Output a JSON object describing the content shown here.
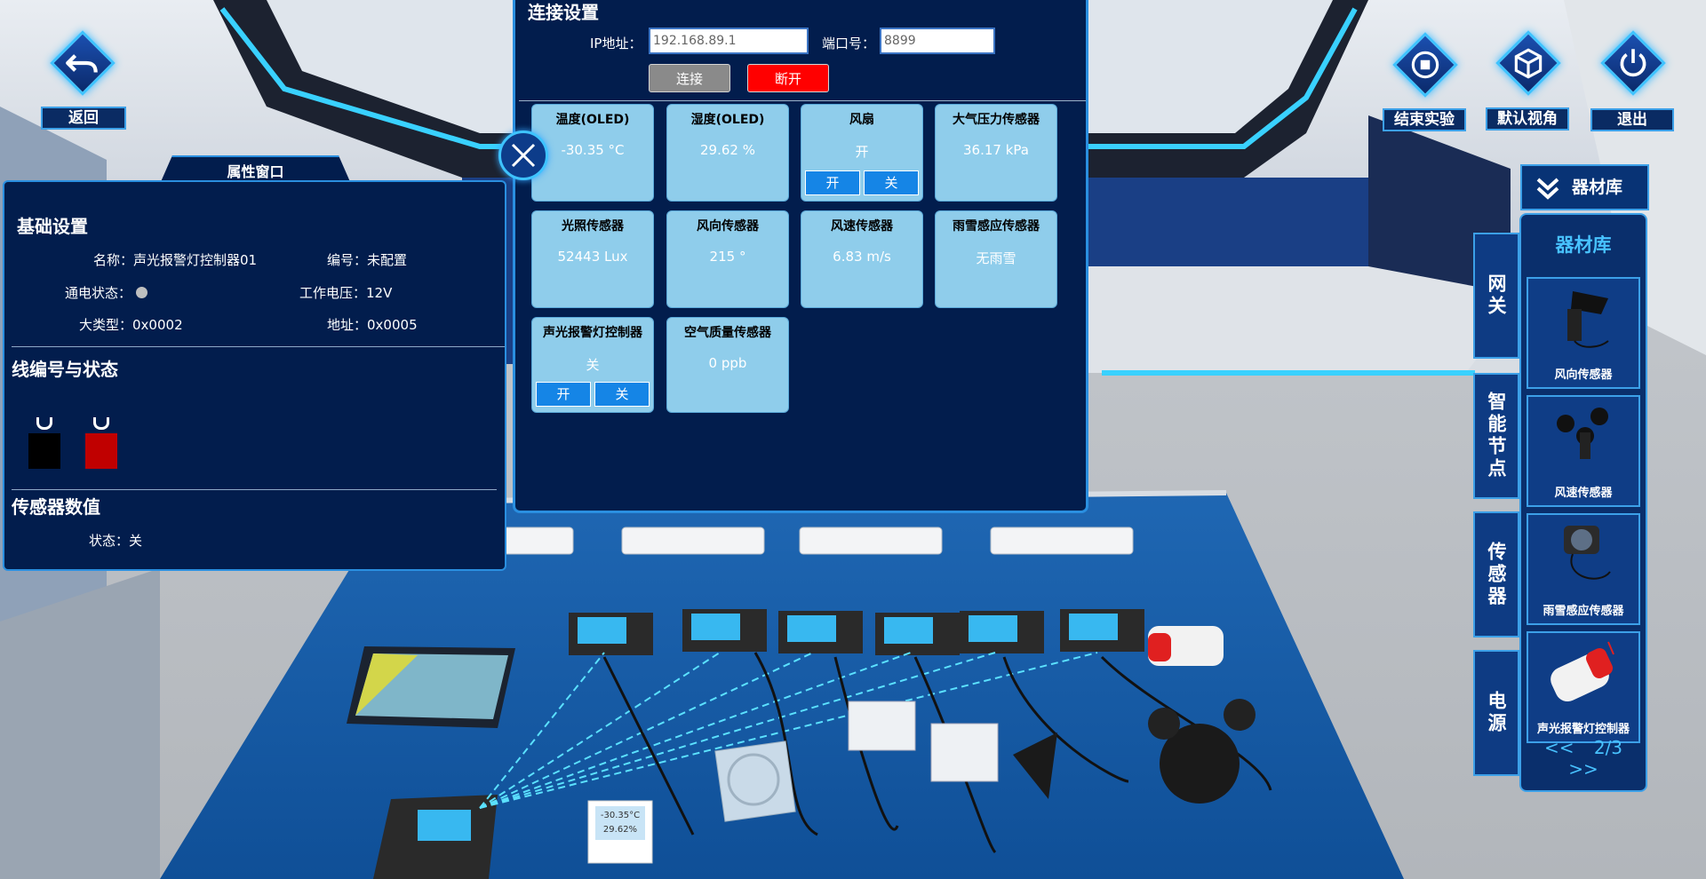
{
  "top_left": {
    "back_label": "返回"
  },
  "top_right": {
    "end_label": "结束实验",
    "view_label": "默认视角",
    "exit_label": "退出"
  },
  "prop_window": {
    "tab": "属性窗口",
    "basic_title": "基础设置",
    "name_key": "名称：",
    "name_val": "声光报警灯控制器01",
    "id_key": "编号：",
    "id_val": "未配置",
    "power_key": "通电状态：",
    "voltage_key": "工作电压：",
    "voltage_val": "12V",
    "type_key": "大类型：",
    "type_val": "0x0002",
    "addr_key": "地址：",
    "addr_val": "0x0005",
    "wire_title": "线编号与状态",
    "sensor_title": "传感器数值",
    "state_key": "状态：",
    "state_val": "关"
  },
  "connection": {
    "title": "连接设置",
    "ip_label": "IP地址：",
    "ip_value": "192.168.89.1",
    "port_label": "端口号：",
    "port_value": "8899",
    "connect_label": "连接",
    "disconnect_label": "断开",
    "cards": [
      {
        "title": "温度(OLED)",
        "value": "-30.35 °C"
      },
      {
        "title": "湿度(OLED)",
        "value": "29.62 %"
      },
      {
        "title": "风扇",
        "value": "开",
        "on": "开",
        "off": "关"
      },
      {
        "title": "大气压力传感器",
        "value": "36.17 kPa"
      },
      {
        "title": "光照传感器",
        "value": "52443 Lux"
      },
      {
        "title": "风向传感器",
        "value": "215 °"
      },
      {
        "title": "风速传感器",
        "value": "6.83 m/s"
      },
      {
        "title": "雨雪感应传感器",
        "value": "无雨雪"
      },
      {
        "title": "声光报警灯控制器",
        "value": "关",
        "on": "开",
        "off": "关"
      },
      {
        "title": "空气质量传感器",
        "value": "0 ppb"
      }
    ]
  },
  "library": {
    "header": "器材库",
    "title": "器材库",
    "tabs": [
      "网关",
      "智能节点",
      "传感器",
      "电源"
    ],
    "items": [
      "风向传感器",
      "风速传感器",
      "雨雪感应传感器",
      "声光报警灯控制器"
    ],
    "prev": "<<",
    "page": "2/3",
    "next": ">>"
  },
  "scene": {
    "oled_temp": "-30.35°C",
    "oled_humi": "29.62%"
  },
  "colors": {
    "panel_bg": "#021d4d",
    "accent": "#3ec3ff",
    "card_bg": "#8fcdeb",
    "disconnect": "#ff0000",
    "connect": "#8a8a8a"
  }
}
